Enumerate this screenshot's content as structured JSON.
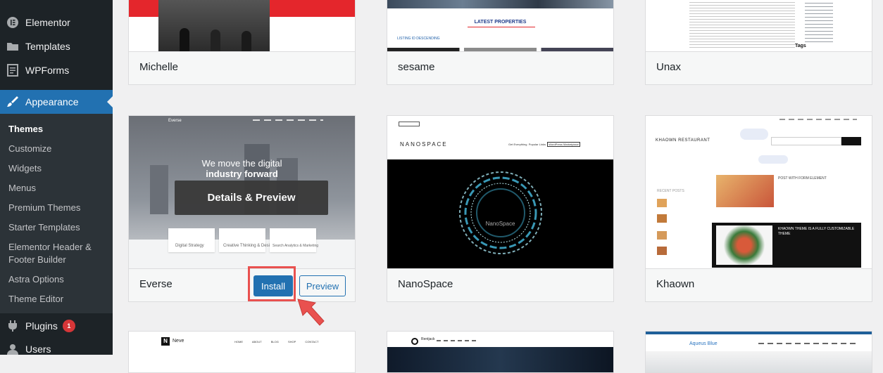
{
  "sidebar": {
    "items": [
      {
        "label": "Elementor",
        "icon": "elementor-icon"
      },
      {
        "label": "Templates",
        "icon": "folder-icon"
      },
      {
        "label": "WPForms",
        "icon": "form-icon"
      },
      {
        "label": "Appearance",
        "icon": "paintbrush-icon"
      }
    ],
    "submenu": [
      "Themes",
      "Customize",
      "Widgets",
      "Menus",
      "Premium Themes",
      "Starter Templates",
      "Elementor Header &",
      "Footer Builder",
      "Astra Options",
      "Theme Editor"
    ],
    "plugins": {
      "label": "Plugins",
      "icon": "plugin-icon",
      "badge": "1"
    },
    "users": {
      "label": "Users",
      "icon": "user-icon"
    }
  },
  "themes": {
    "michelle": {
      "name": "Michelle"
    },
    "sesame": {
      "name": "sesame",
      "shot_title": "LATEST PROPERTIES",
      "shot_filter": "LISTING ID DESCENDING"
    },
    "unax": {
      "name": "Unax",
      "shot_tags": "Tags"
    },
    "everse": {
      "name": "Everse",
      "headline_1": "We move the digital",
      "headline_2": "industry forward",
      "overlay": "Details & Preview",
      "install": "Install",
      "preview": "Preview",
      "nav_brand": "Everse",
      "features": [
        "Digital Strategy",
        "Creative Thinking & Design",
        "Search Analytics & Marketing"
      ]
    },
    "nanospace": {
      "name": "NanoSpace",
      "shot_logo": "NANOSPACE",
      "shot_center": "NanoSpace",
      "shot_nav": [
        "Get Everything",
        "Popular Links",
        "WordPress Marketplace"
      ]
    },
    "khaown": {
      "name": "Khaown",
      "shot_logo": "KHAOWN RESTAURANT",
      "shot_post": "POST WITH FORM ELEMENT",
      "shot_post2": "KHAOWN THEME IS A FULLY CUSTOMIZABLE THEME",
      "shot_recent": "RECENT POSTS"
    },
    "neve": {
      "brand": "Neve",
      "nav": [
        "HOME",
        "ABOUT",
        "BLOG",
        "SHOP",
        "CONTACT"
      ]
    },
    "row3b": {
      "brand": "Rentjack"
    },
    "row3c": {
      "brand": "Aqueus Blue"
    }
  }
}
